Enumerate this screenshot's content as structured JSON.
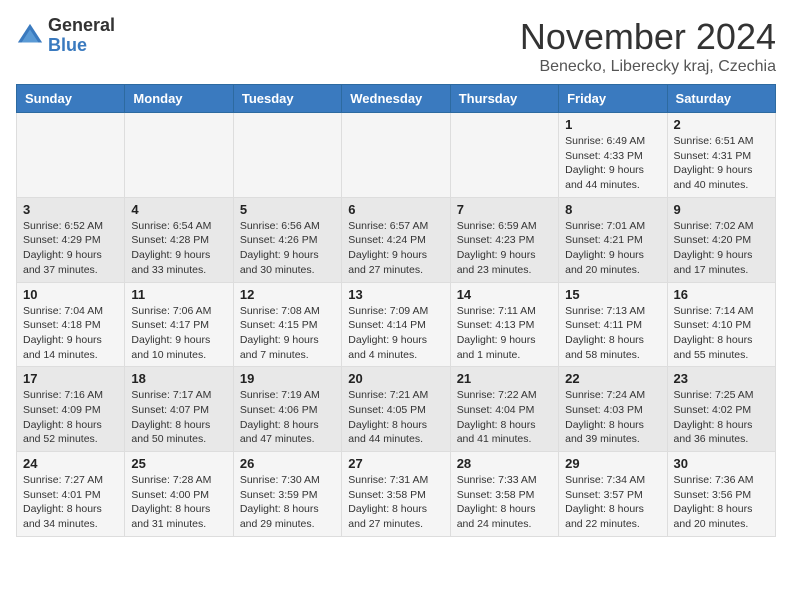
{
  "logo": {
    "general": "General",
    "blue": "Blue"
  },
  "title": "November 2024",
  "location": "Benecko, Liberecky kraj, Czechia",
  "days_header": [
    "Sunday",
    "Monday",
    "Tuesday",
    "Wednesday",
    "Thursday",
    "Friday",
    "Saturday"
  ],
  "weeks": [
    [
      {
        "day": "",
        "info": ""
      },
      {
        "day": "",
        "info": ""
      },
      {
        "day": "",
        "info": ""
      },
      {
        "day": "",
        "info": ""
      },
      {
        "day": "",
        "info": ""
      },
      {
        "day": "1",
        "info": "Sunrise: 6:49 AM\nSunset: 4:33 PM\nDaylight: 9 hours and 44 minutes."
      },
      {
        "day": "2",
        "info": "Sunrise: 6:51 AM\nSunset: 4:31 PM\nDaylight: 9 hours and 40 minutes."
      }
    ],
    [
      {
        "day": "3",
        "info": "Sunrise: 6:52 AM\nSunset: 4:29 PM\nDaylight: 9 hours and 37 minutes."
      },
      {
        "day": "4",
        "info": "Sunrise: 6:54 AM\nSunset: 4:28 PM\nDaylight: 9 hours and 33 minutes."
      },
      {
        "day": "5",
        "info": "Sunrise: 6:56 AM\nSunset: 4:26 PM\nDaylight: 9 hours and 30 minutes."
      },
      {
        "day": "6",
        "info": "Sunrise: 6:57 AM\nSunset: 4:24 PM\nDaylight: 9 hours and 27 minutes."
      },
      {
        "day": "7",
        "info": "Sunrise: 6:59 AM\nSunset: 4:23 PM\nDaylight: 9 hours and 23 minutes."
      },
      {
        "day": "8",
        "info": "Sunrise: 7:01 AM\nSunset: 4:21 PM\nDaylight: 9 hours and 20 minutes."
      },
      {
        "day": "9",
        "info": "Sunrise: 7:02 AM\nSunset: 4:20 PM\nDaylight: 9 hours and 17 minutes."
      }
    ],
    [
      {
        "day": "10",
        "info": "Sunrise: 7:04 AM\nSunset: 4:18 PM\nDaylight: 9 hours and 14 minutes."
      },
      {
        "day": "11",
        "info": "Sunrise: 7:06 AM\nSunset: 4:17 PM\nDaylight: 9 hours and 10 minutes."
      },
      {
        "day": "12",
        "info": "Sunrise: 7:08 AM\nSunset: 4:15 PM\nDaylight: 9 hours and 7 minutes."
      },
      {
        "day": "13",
        "info": "Sunrise: 7:09 AM\nSunset: 4:14 PM\nDaylight: 9 hours and 4 minutes."
      },
      {
        "day": "14",
        "info": "Sunrise: 7:11 AM\nSunset: 4:13 PM\nDaylight: 9 hours and 1 minute."
      },
      {
        "day": "15",
        "info": "Sunrise: 7:13 AM\nSunset: 4:11 PM\nDaylight: 8 hours and 58 minutes."
      },
      {
        "day": "16",
        "info": "Sunrise: 7:14 AM\nSunset: 4:10 PM\nDaylight: 8 hours and 55 minutes."
      }
    ],
    [
      {
        "day": "17",
        "info": "Sunrise: 7:16 AM\nSunset: 4:09 PM\nDaylight: 8 hours and 52 minutes."
      },
      {
        "day": "18",
        "info": "Sunrise: 7:17 AM\nSunset: 4:07 PM\nDaylight: 8 hours and 50 minutes."
      },
      {
        "day": "19",
        "info": "Sunrise: 7:19 AM\nSunset: 4:06 PM\nDaylight: 8 hours and 47 minutes."
      },
      {
        "day": "20",
        "info": "Sunrise: 7:21 AM\nSunset: 4:05 PM\nDaylight: 8 hours and 44 minutes."
      },
      {
        "day": "21",
        "info": "Sunrise: 7:22 AM\nSunset: 4:04 PM\nDaylight: 8 hours and 41 minutes."
      },
      {
        "day": "22",
        "info": "Sunrise: 7:24 AM\nSunset: 4:03 PM\nDaylight: 8 hours and 39 minutes."
      },
      {
        "day": "23",
        "info": "Sunrise: 7:25 AM\nSunset: 4:02 PM\nDaylight: 8 hours and 36 minutes."
      }
    ],
    [
      {
        "day": "24",
        "info": "Sunrise: 7:27 AM\nSunset: 4:01 PM\nDaylight: 8 hours and 34 minutes."
      },
      {
        "day": "25",
        "info": "Sunrise: 7:28 AM\nSunset: 4:00 PM\nDaylight: 8 hours and 31 minutes."
      },
      {
        "day": "26",
        "info": "Sunrise: 7:30 AM\nSunset: 3:59 PM\nDaylight: 8 hours and 29 minutes."
      },
      {
        "day": "27",
        "info": "Sunrise: 7:31 AM\nSunset: 3:58 PM\nDaylight: 8 hours and 27 minutes."
      },
      {
        "day": "28",
        "info": "Sunrise: 7:33 AM\nSunset: 3:58 PM\nDaylight: 8 hours and 24 minutes."
      },
      {
        "day": "29",
        "info": "Sunrise: 7:34 AM\nSunset: 3:57 PM\nDaylight: 8 hours and 22 minutes."
      },
      {
        "day": "30",
        "info": "Sunrise: 7:36 AM\nSunset: 3:56 PM\nDaylight: 8 hours and 20 minutes."
      }
    ]
  ]
}
